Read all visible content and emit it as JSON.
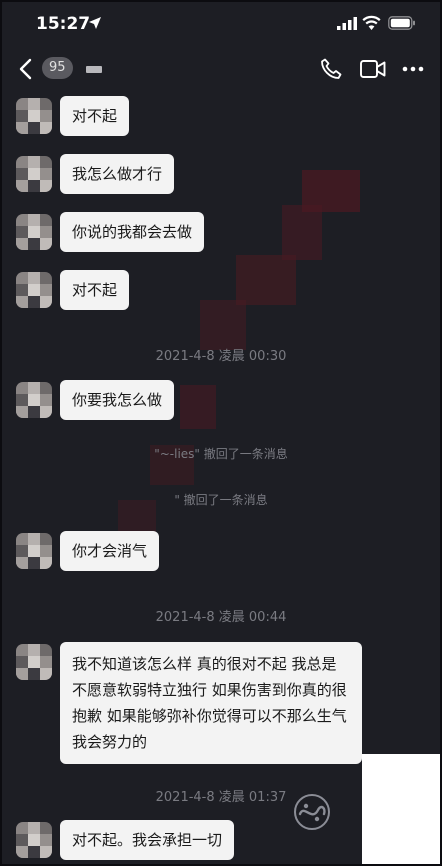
{
  "status_bar": {
    "time": "15:27"
  },
  "nav": {
    "contact_badge": "95"
  },
  "messages": [
    {
      "text": "对不起"
    },
    {
      "text": "我怎么做才行"
    },
    {
      "text": "你说的我都会去做"
    },
    {
      "text": "对不起"
    },
    {
      "text": "你要我怎么做"
    },
    {
      "text": "你才会消气"
    },
    {
      "text": "我不知道该怎么样 真的很对不起 我总是不愿意软弱特立独行 如果伤害到你真的很抱歉 如果能够弥补你觉得可以不那么生气 我会努力的"
    },
    {
      "text": "对不起。我会承担一切"
    }
  ],
  "timestamps": [
    "2021-4-8 凌晨 00:30",
    "2021-4-8 凌晨 00:44",
    "2021-4-8 凌晨 01:37"
  ],
  "recalls": [
    {
      "name": "\"~-lies\"",
      "text": "撤回了一条消息"
    },
    {
      "name": "\"",
      "text": "撤回了一条消息"
    }
  ],
  "colors": {
    "background": "#1d1e24",
    "bubble": "#f3f3f3",
    "system_text": "#7a7b82",
    "watermark": "#4a1a22"
  },
  "icons": [
    "location-arrow-icon",
    "signal-icon",
    "wifi-icon",
    "battery-icon",
    "back-icon",
    "phone-icon",
    "video-icon",
    "more-icon"
  ]
}
